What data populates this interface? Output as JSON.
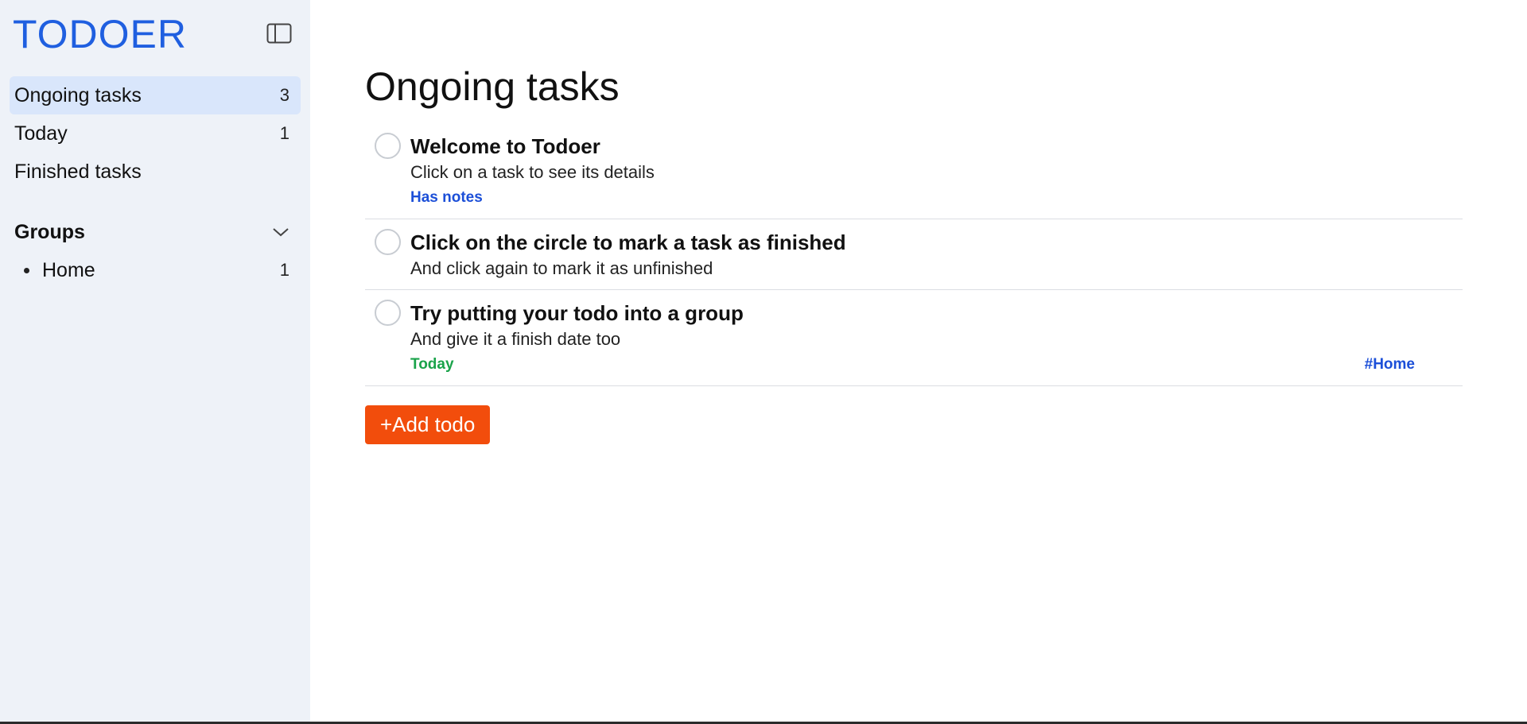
{
  "app": {
    "title": "TODOER"
  },
  "sidebar": {
    "nav": [
      {
        "label": "Ongoing tasks",
        "count": "3",
        "active": true
      },
      {
        "label": "Today",
        "count": "1",
        "active": false
      },
      {
        "label": "Finished tasks",
        "count": "",
        "active": false
      }
    ],
    "groups_title": "Groups",
    "groups": [
      {
        "label": "Home",
        "count": "1"
      }
    ]
  },
  "main": {
    "title": "Ongoing tasks",
    "tasks": [
      {
        "title": "Welcome to Todoer",
        "description": "Click on a task to see its details",
        "notes_label": "Has notes"
      },
      {
        "title": "Click on the circle to mark a task as finished",
        "description": "And click again to mark it as unfinished"
      },
      {
        "title": "Try putting your todo into a group",
        "description": "And give it a finish date too",
        "date_label": "Today",
        "group_label": "#Home"
      }
    ],
    "add_button": "+Add todo"
  },
  "icons": {
    "sidebar_toggle": "sidebar-toggle-icon",
    "groups_chevron": "chevron-down-icon"
  },
  "colors": {
    "brand": "#1f5fe0",
    "sidebar_bg": "#eef2f8",
    "active_nav_bg": "#d9e6fb",
    "add_button": "#f24d0c",
    "notes": "#1c4fd8",
    "date": "#1aa34a",
    "group_tag": "#1c4fd8"
  }
}
